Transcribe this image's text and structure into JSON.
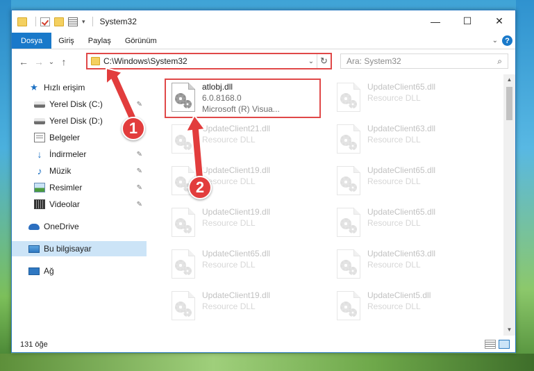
{
  "window": {
    "title": "System32",
    "controls": {
      "minimize": "—",
      "maximize": "☐",
      "close": "✕"
    }
  },
  "ribbon": {
    "tabs": [
      "Dosya",
      "Giriş",
      "Paylaş",
      "Görünüm"
    ],
    "expand_icon": "chevron-down-icon",
    "help": "?"
  },
  "nav": {
    "back": "←",
    "forward": "→",
    "recent": "⌄",
    "up": "↑",
    "address": "C:\\Windows\\System32",
    "address_dropdown": "⌄",
    "refresh": "↻",
    "search_placeholder": "Ara: System32",
    "search_icon": "⌕"
  },
  "sidebar": {
    "items": [
      {
        "label": "Hızlı erişim",
        "icon": "quick-access-icon",
        "pinned": false
      },
      {
        "label": "Yerel Disk (C:)",
        "icon": "disk-icon",
        "pinned": true
      },
      {
        "label": "Yerel Disk (D:)",
        "icon": "disk-icon",
        "pinned": false
      },
      {
        "label": "Belgeler",
        "icon": "documents-icon",
        "pinned": false
      },
      {
        "label": "İndirmeler",
        "icon": "downloads-icon",
        "pinned": true
      },
      {
        "label": "Müzik",
        "icon": "music-icon",
        "pinned": true
      },
      {
        "label": "Resimler",
        "icon": "pictures-icon",
        "pinned": true
      },
      {
        "label": "Videolar",
        "icon": "videos-icon",
        "pinned": true
      },
      {
        "label": "OneDrive",
        "icon": "onedrive-icon",
        "pinned": false
      },
      {
        "label": "Bu bilgisayar",
        "icon": "this-pc-icon",
        "pinned": false,
        "selected": true
      },
      {
        "label": "Ağ",
        "icon": "network-icon",
        "pinned": false
      }
    ],
    "pin_glyph": "📌"
  },
  "files": {
    "highlighted": {
      "name": "atlobj.dll",
      "version": "6.0.8168.0",
      "description": "Microsoft (R) Visua..."
    },
    "left_column": [
      {
        "name": "UpdateClient21.dll",
        "type": "Resource DLL"
      },
      {
        "name": "UpdateClient19.dll",
        "type": "Resource DLL"
      },
      {
        "name": "UpdateClient19.dll",
        "type": "Resource DLL"
      },
      {
        "name": "UpdateClient65.dll",
        "type": "Resource DLL"
      },
      {
        "name": "UpdateClient19.dll",
        "type": "Resource DLL"
      }
    ],
    "right_column": [
      {
        "name": "UpdateClient65.dll",
        "type": "Resource DLL"
      },
      {
        "name": "UpdateClient63.dll",
        "type": "Resource DLL"
      },
      {
        "name": "UpdateClient65.dll",
        "type": "Resource DLL"
      },
      {
        "name": "UpdateClient65.dll",
        "type": "Resource DLL"
      },
      {
        "name": "UpdateClient63.dll",
        "type": "Resource DLL"
      },
      {
        "name": "UpdateClient5.dll",
        "type": "Resource DLL"
      }
    ]
  },
  "status": {
    "item_count": "131 öğe"
  },
  "annotations": {
    "step1": "1",
    "step2": "2",
    "accent_color": "#e23d3d"
  }
}
